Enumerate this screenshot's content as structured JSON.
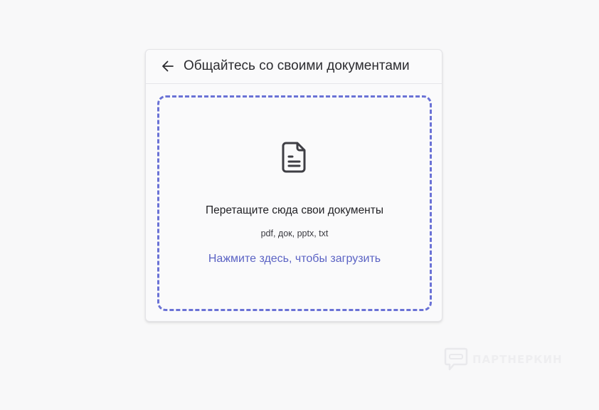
{
  "dialog": {
    "title": "Общайтесь со своими документами",
    "back_icon": "arrow-left-icon"
  },
  "dropzone": {
    "icon": "document-icon",
    "instruction": "Перетащите сюда свои документы",
    "formats": "pdf, док, pptx, txt",
    "upload_link": "Нажмите здесь, чтобы загрузить",
    "border_color": "#6a72d6",
    "link_color": "#5b63c4"
  },
  "watermark": {
    "text": "ПАРТНЕРКИН",
    "icon": "chat-bubble-icon"
  }
}
